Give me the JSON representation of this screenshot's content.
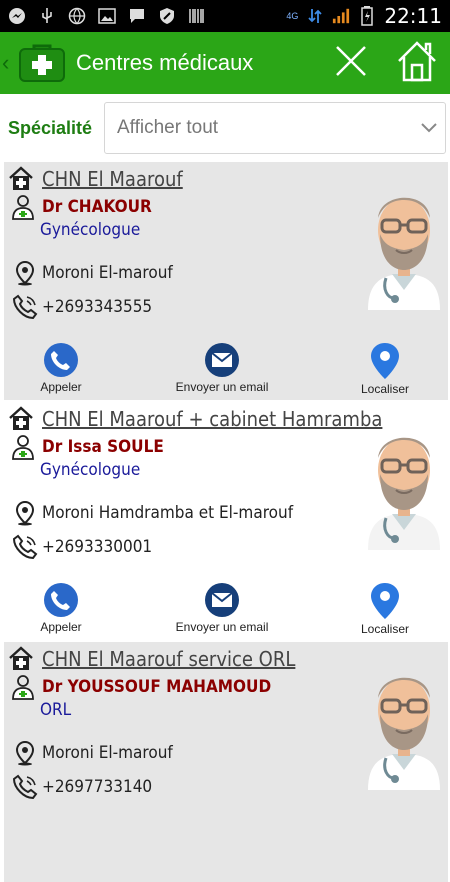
{
  "statusbar": {
    "network": "4G",
    "time": "22:11"
  },
  "appbar": {
    "title": "Centres médicaux",
    "brand_color": "#2ba617"
  },
  "filter": {
    "label": "Spécialité",
    "selected": "Afficher tout"
  },
  "actions": {
    "call": "Appeler",
    "email": "Envoyer un email",
    "locate": "Localiser"
  },
  "cards": [
    {
      "center": "CHN El Maarouf",
      "doctor": "Dr CHAKOUR",
      "specialty": "Gynécologue",
      "address": "Moroni El-marouf",
      "phone": "+2693343555"
    },
    {
      "center": "CHN El Maarouf + cabinet Hamramba",
      "doctor": "Dr Issa SOULE",
      "specialty": "Gynécologue",
      "address": "Moroni Hamdramba et El-marouf",
      "phone": "+2693330001"
    },
    {
      "center": "CHN El Maarouf service ORL",
      "doctor": "Dr YOUSSOUF MAHAMOUD",
      "specialty": "ORL",
      "address": "Moroni El-marouf",
      "phone": "+2697733140"
    }
  ]
}
